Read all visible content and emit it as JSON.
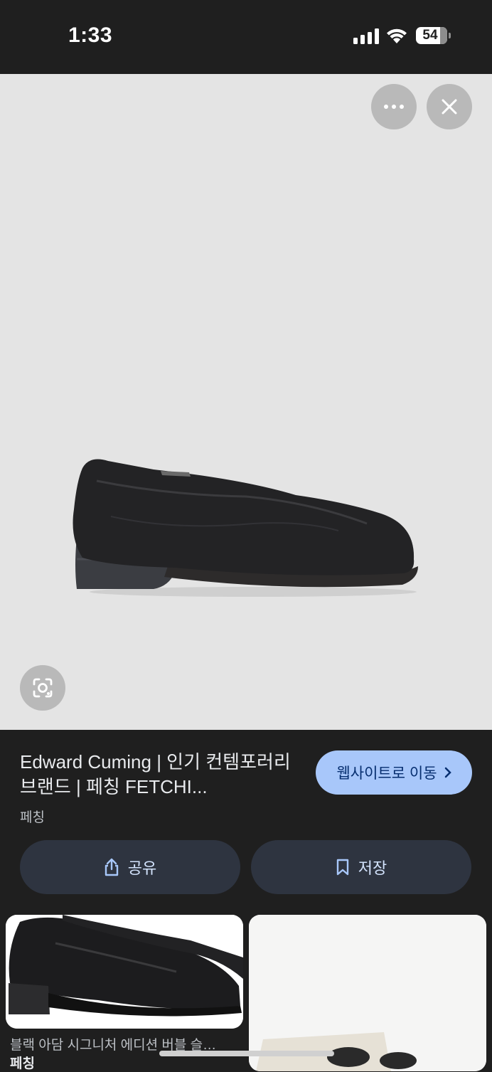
{
  "status_bar": {
    "time": "1:33",
    "battery": "54"
  },
  "viewer": {
    "more_icon": "more-horizontal-icon",
    "close_icon": "close-icon",
    "lens_icon": "lens-icon"
  },
  "result": {
    "title": "Edward Cuming | 인기 컨템포러리 브랜드 | 페칭 FETCHI...",
    "source": "페칭",
    "visit_label": "웹사이트로 이동",
    "share_label": "공유",
    "save_label": "저장"
  },
  "related": [
    {
      "caption": "블랙 아담 시그니처 에디션 버블 슬…",
      "source": "페칭"
    },
    {
      "caption": "",
      "source": ""
    }
  ],
  "colors": {
    "accent": "#a8c7fa",
    "panel": "#1f1f1f",
    "button": "#2e3440"
  }
}
